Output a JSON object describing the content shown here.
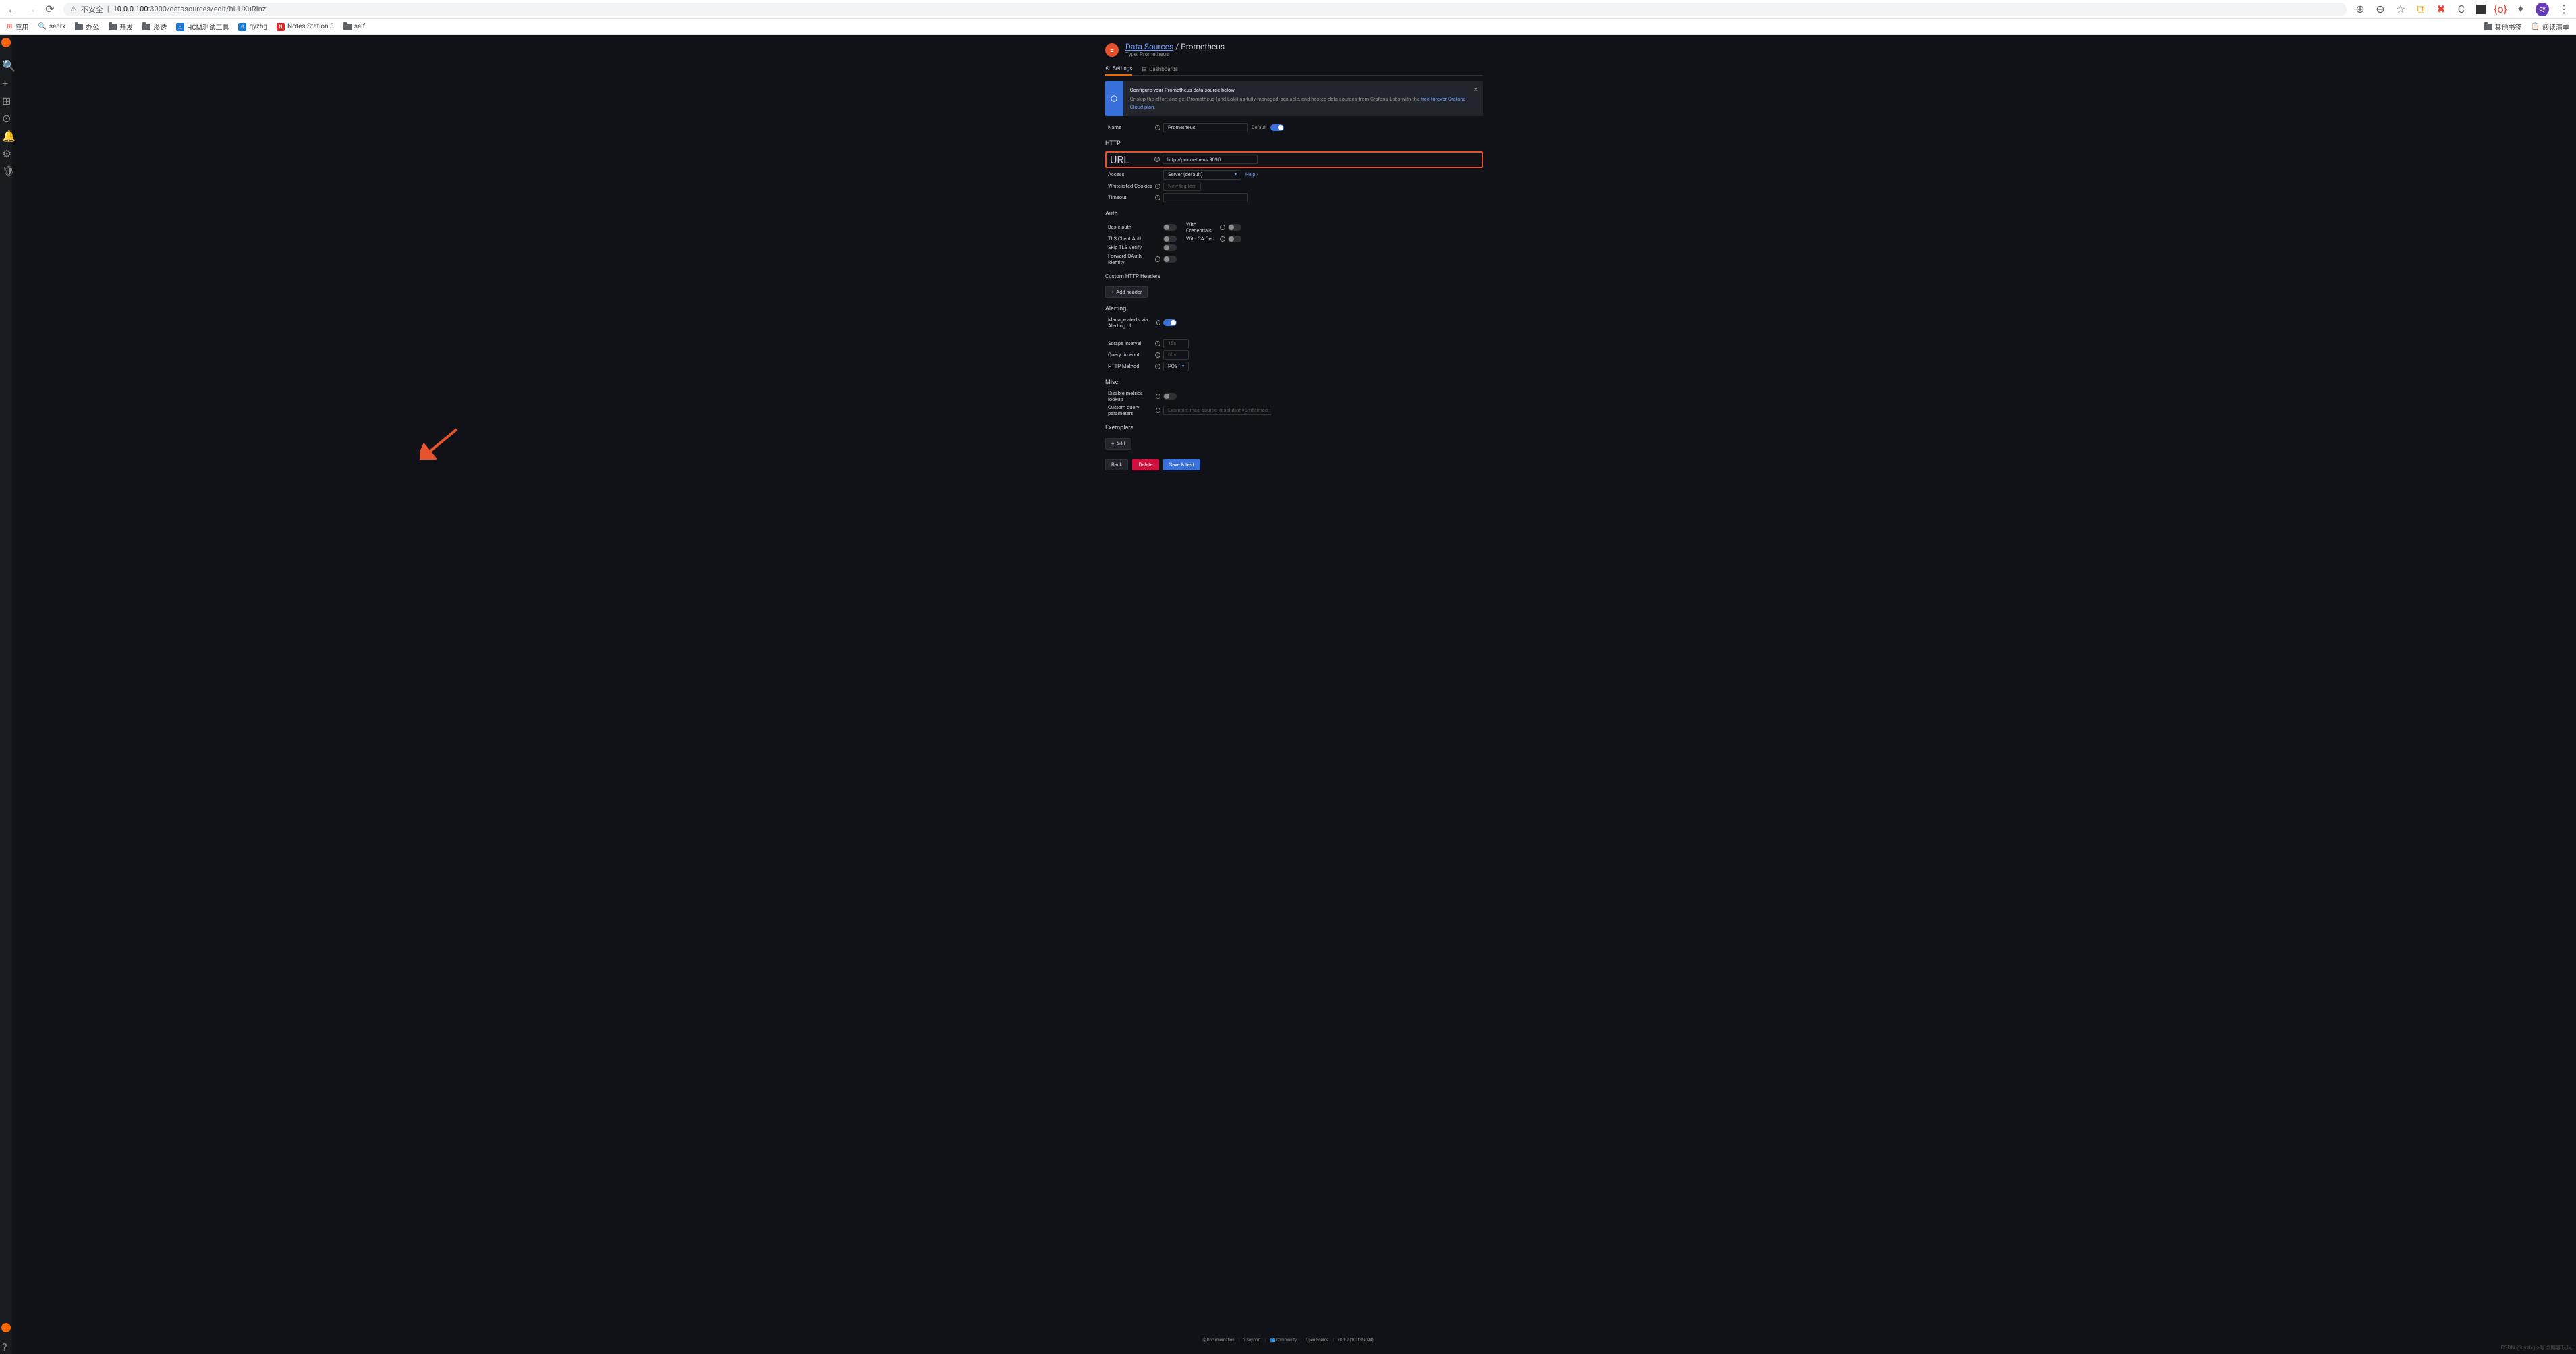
{
  "browser": {
    "insecure_label": "不安全",
    "url_host": "10.0.0.100",
    "url_port": ":3000",
    "url_path": "/datasources/edit/bUUXuRInz",
    "avatar_initials": "qy"
  },
  "bookmarks": {
    "apps": "应用",
    "items": [
      "searx",
      "办公",
      "开发",
      "渗透",
      "HCM测试工具",
      "qyzhg",
      "Notes Station 3",
      "self"
    ],
    "right": [
      "其他书签",
      "阅读清单"
    ]
  },
  "breadcrumb": {
    "parent": "Data Sources",
    "sep": "/",
    "current": "Prometheus",
    "subtitle": "Type: Prometheus"
  },
  "tabs": {
    "settings": "Settings",
    "dashboards": "Dashboards"
  },
  "banner": {
    "title": "Configure your Prometheus data source below",
    "sub_pre": "Or skip the effort and get Prometheus (and Loki) as fully-managed, scalable, and hosted data sources from Grafana Labs with the ",
    "link": "free-forever Grafana Cloud plan",
    "sub_post": "."
  },
  "name_row": {
    "label": "Name",
    "value": "Prometheus",
    "default_label": "Default"
  },
  "http": {
    "title": "HTTP",
    "url_label": "URL",
    "url_value": "http://prometheus:9090",
    "access_label": "Access",
    "access_value": "Server (default)",
    "help": "Help ›",
    "cookies_label": "Whitelisted Cookies",
    "cookies_placeholder": "New tag (enter key t",
    "timeout_label": "Timeout"
  },
  "auth": {
    "title": "Auth",
    "basic": "Basic auth",
    "with_creds": "With Credentials",
    "tls_client": "TLS Client Auth",
    "with_ca": "With CA Cert",
    "skip_tls": "Skip TLS Verify",
    "forward_oauth": "Forward OAuth Identity"
  },
  "custom_headers": {
    "title": "Custom HTTP Headers",
    "add": "Add header"
  },
  "alerting": {
    "title": "Alerting",
    "manage_label": "Manage alerts via Alerting UI",
    "scrape_label": "Scrape interval",
    "scrape_value": "15s",
    "query_timeout_label": "Query timeout",
    "query_timeout_value": "60s",
    "http_method_label": "HTTP Method",
    "http_method_value": "POST"
  },
  "misc": {
    "title": "Misc",
    "disable_metrics": "Disable metrics lookup",
    "custom_query_label": "Custom query parameters",
    "custom_query_placeholder": "Example: max_source_resolution=5m&timeout=10"
  },
  "exemplars": {
    "title": "Exemplars",
    "add": "Add"
  },
  "buttons": {
    "back": "Back",
    "delete": "Delete",
    "save": "Save & test"
  },
  "footer": {
    "items": [
      "Documentation",
      "Support",
      "Community",
      "Open Source",
      "v8.1.2 (103f8fa094)"
    ],
    "doc_icon": "⎘",
    "support_icon": "?",
    "community_icon": "👥"
  },
  "watermark": "CSDN @qyzhg->写点博客玩玩"
}
